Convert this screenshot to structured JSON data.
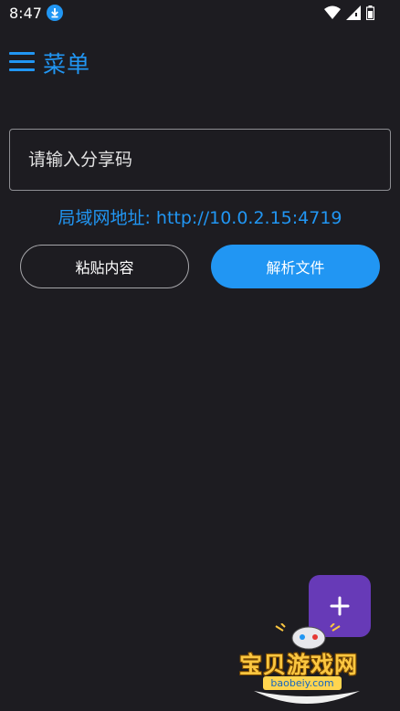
{
  "status_bar": {
    "time": "8:47",
    "icons": [
      "download-icon",
      "wifi-icon",
      "signal-icon",
      "battery-icon"
    ]
  },
  "app_bar": {
    "title": "菜单",
    "menu_icon": "hamburger-menu-icon"
  },
  "share_code": {
    "placeholder": "请输入分享码",
    "value": ""
  },
  "lan_address": "局域网地址: http://10.0.2.15:4719",
  "buttons": {
    "paste_label": "粘贴内容",
    "parse_label": "解析文件"
  },
  "fab": {
    "icon": "plus-icon"
  },
  "watermark": {
    "brand": "宝贝游戏网",
    "url": "baobeiy.com"
  },
  "colors": {
    "background": "#1d1c21",
    "accent": "#2196f3",
    "fab": "#673ab7",
    "watermark": "#fbc640"
  }
}
